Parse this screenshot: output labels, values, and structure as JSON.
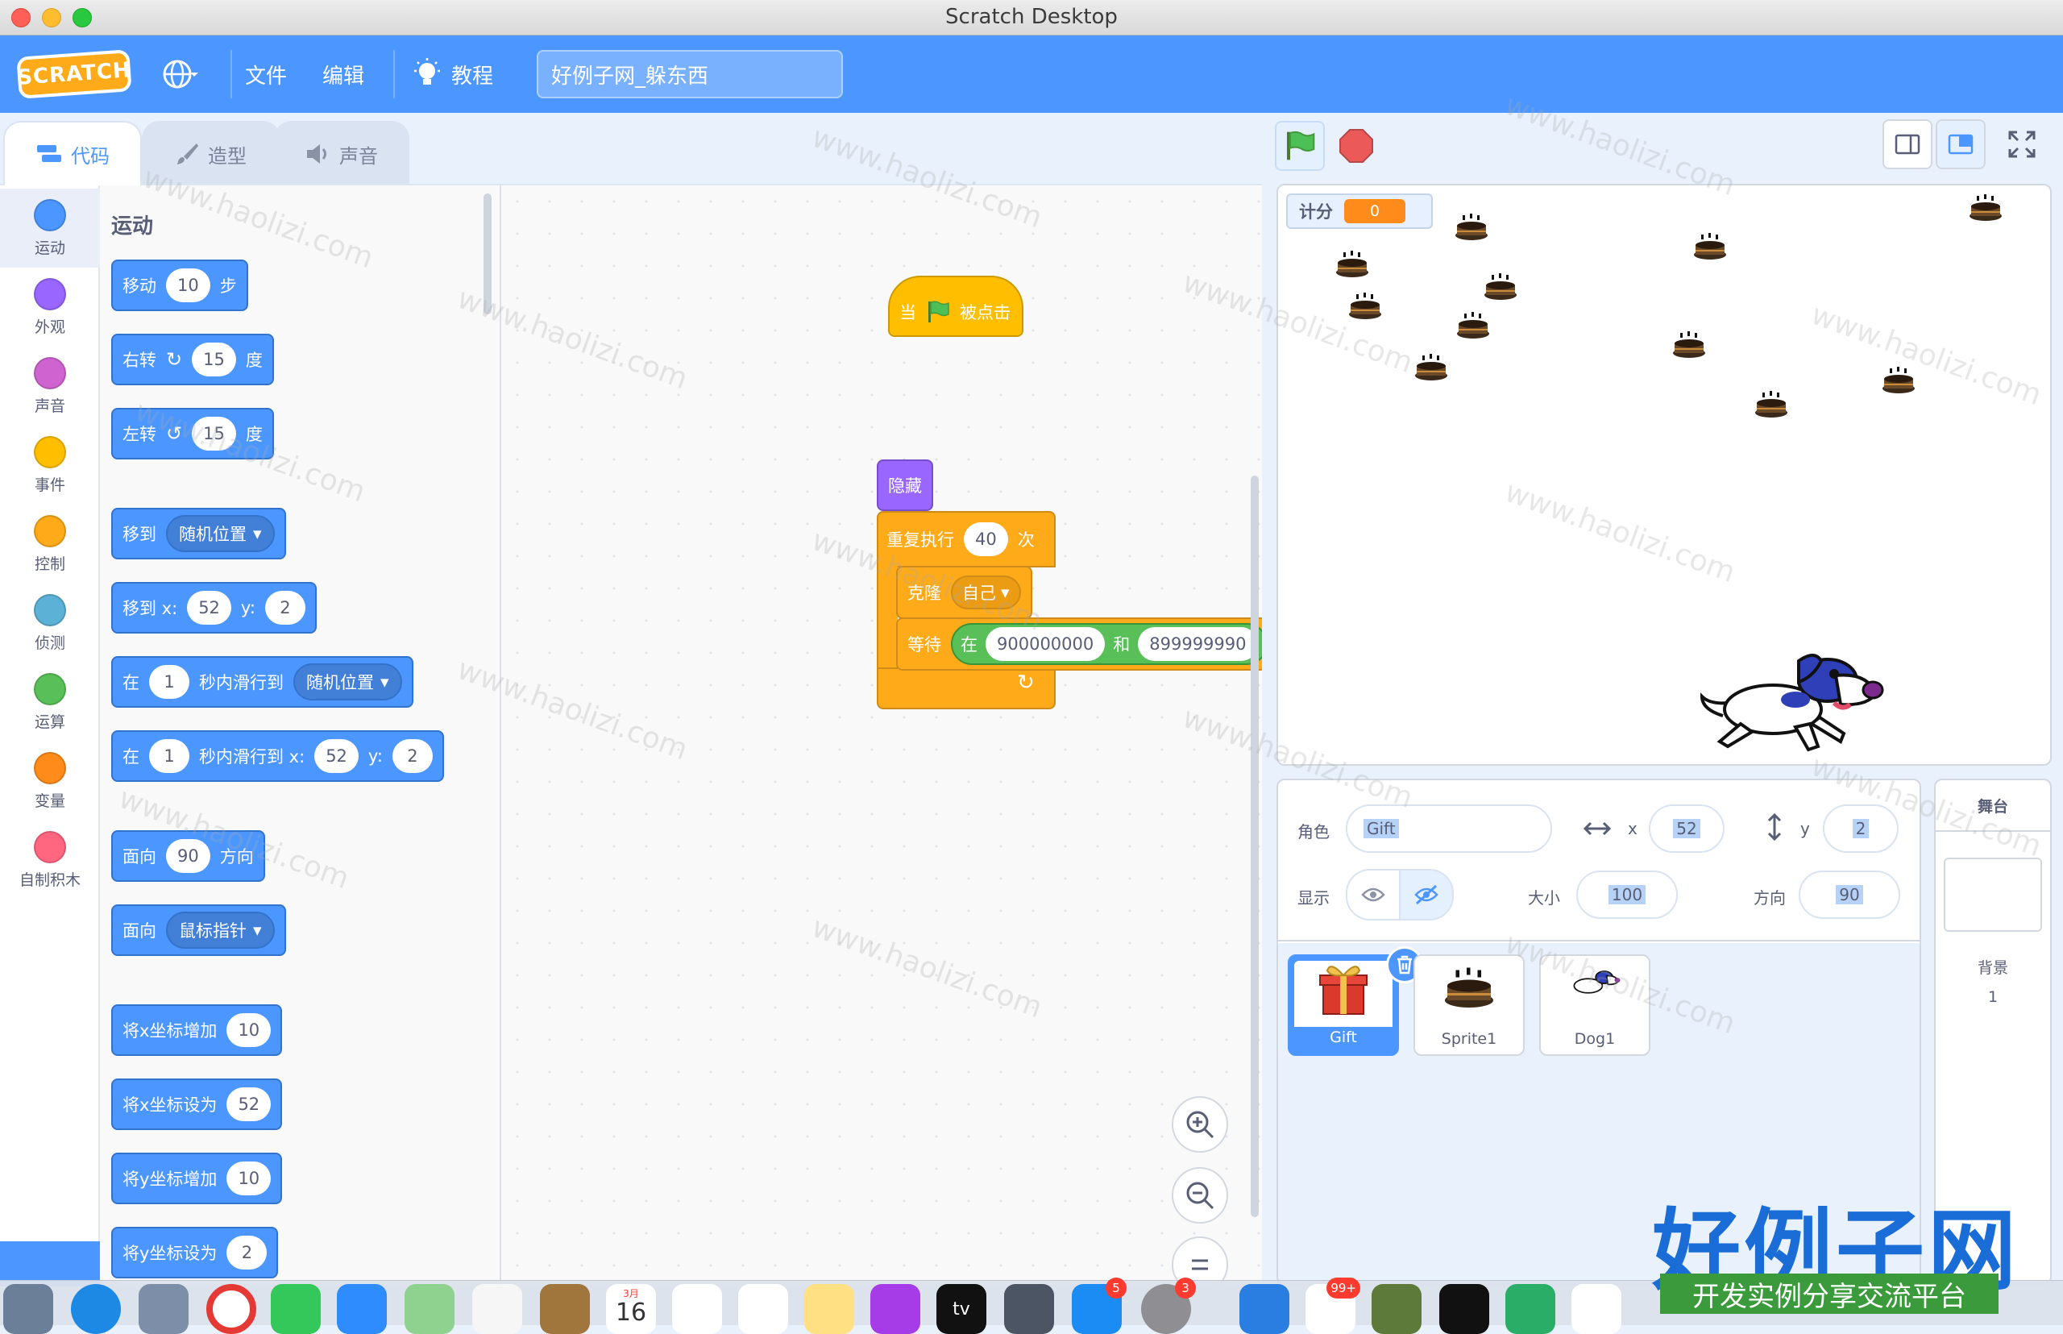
{
  "window": {
    "title": "Scratch Desktop"
  },
  "menubar": {
    "logo": "SCRATCH",
    "file": "文件",
    "edit": "编辑",
    "tutorials": "教程",
    "project_title": "好例子网_躲东西"
  },
  "tabs": [
    {
      "label": "代码"
    },
    {
      "label": "造型"
    },
    {
      "label": "声音"
    }
  ],
  "categories": [
    {
      "label": "运动",
      "color": "#4c97ff"
    },
    {
      "label": "外观",
      "color": "#9966ff"
    },
    {
      "label": "声音",
      "color": "#cf63cf"
    },
    {
      "label": "事件",
      "color": "#ffbf00"
    },
    {
      "label": "控制",
      "color": "#ffab19"
    },
    {
      "label": "侦测",
      "color": "#5cb1d6"
    },
    {
      "label": "运算",
      "color": "#59c059"
    },
    {
      "label": "变量",
      "color": "#ff8c1a"
    },
    {
      "label": "自制积木",
      "color": "#ff6680"
    }
  ],
  "palette": {
    "heading": "运动",
    "move": {
      "a": "移动",
      "val": "10",
      "b": "步"
    },
    "turn_right": {
      "a": "右转",
      "val": "15",
      "b": "度"
    },
    "turn_left": {
      "a": "左转",
      "val": "15",
      "b": "度"
    },
    "goto": {
      "a": "移到",
      "dd": "随机位置"
    },
    "goto_xy": {
      "a": "移到 x:",
      "x": "52",
      "yl": "y:",
      "y": "2"
    },
    "glide": {
      "a": "在",
      "val": "1",
      "b": "秒内滑行到",
      "dd": "随机位置"
    },
    "glide_xy": {
      "a": "在",
      "val": "1",
      "b": "秒内滑行到 x:",
      "x": "52",
      "yl": "y:",
      "y": "2"
    },
    "point_dir": {
      "a": "面向",
      "val": "90",
      "b": "方向"
    },
    "point_towards": {
      "a": "面向",
      "dd": "鼠标指针"
    },
    "change_x": {
      "a": "将x坐标增加",
      "val": "10"
    },
    "set_x": {
      "a": "将x坐标设为",
      "val": "52"
    },
    "change_y": {
      "a": "将y坐标增加",
      "val": "10"
    },
    "set_y": {
      "a": "将y坐标设为",
      "val": "2"
    }
  },
  "script": {
    "hat": {
      "a": "当",
      "b": "被点击"
    },
    "hide": "隐藏",
    "repeat": {
      "a": "重复执行",
      "val": "40",
      "b": "次"
    },
    "clone": {
      "a": "克隆",
      "dd": "自己"
    },
    "wait": {
      "a": "等待",
      "b": "在",
      "v1": "900000000",
      "c": "和",
      "v2": "899999990"
    }
  },
  "stage": {
    "monitor_label": "计分",
    "monitor_value": "0"
  },
  "sprite_info": {
    "sprite_label": "角色",
    "sprite_name": "Gift",
    "x_label": "x",
    "x": "52",
    "y_label": "y",
    "y": "2",
    "show_label": "显示",
    "size_label": "大小",
    "size": "100",
    "direction_label": "方向",
    "direction": "90"
  },
  "sprites": [
    {
      "name": "Gift"
    },
    {
      "name": "Sprite1"
    },
    {
      "name": "Dog1"
    }
  ],
  "stage_panel": {
    "title": "舞台",
    "backdrop_label": "背景",
    "backdrop_count": "1"
  },
  "watermark": {
    "text": "www.haolizi.com",
    "big": "好例子网",
    "banner": "开发实例分享交流平台"
  },
  "dock": {
    "calendar_month": "3月",
    "calendar_day": "16",
    "tv_label": "tv",
    "appstore_badge": "5",
    "settings_badge": "3",
    "qq_badge": "99+"
  }
}
